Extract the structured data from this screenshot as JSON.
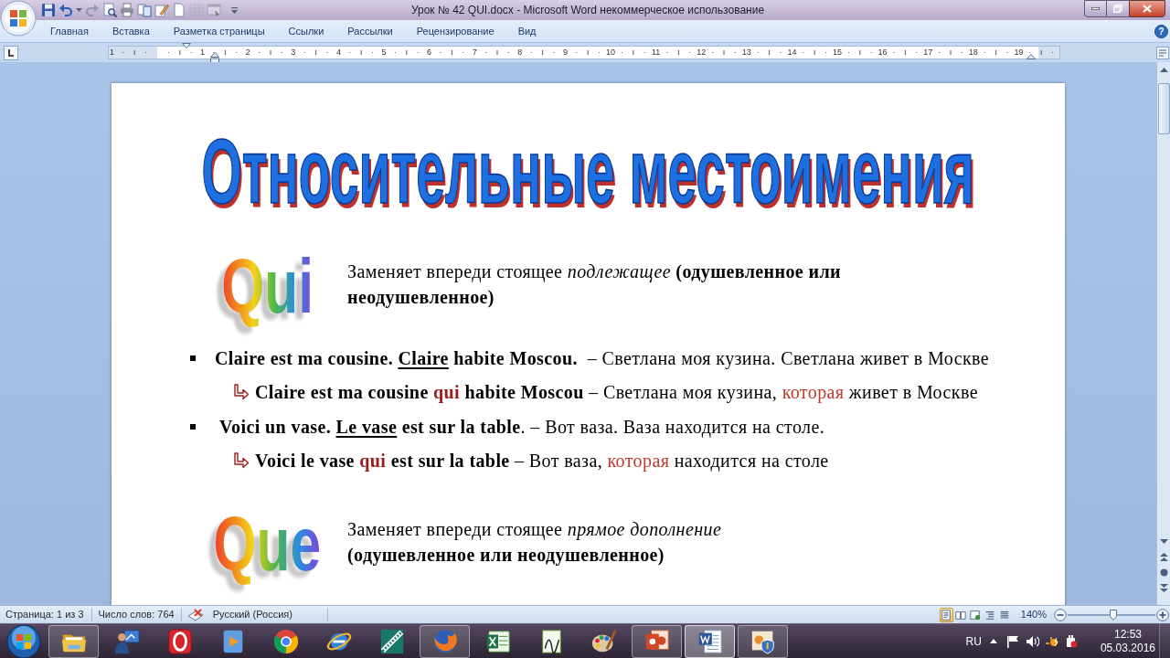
{
  "window": {
    "title": "Урок № 42 QUI.docx - Microsoft Word некоммерческое использование"
  },
  "quick_access": [
    {
      "kind": "save",
      "disabled": false
    },
    {
      "kind": "undo",
      "disabled": false
    },
    {
      "kind": "caret",
      "disabled": false
    },
    {
      "kind": "redo",
      "disabled": true
    },
    {
      "kind": "preview",
      "disabled": false
    },
    {
      "kind": "print",
      "disabled": false
    },
    {
      "kind": "pages",
      "disabled": false
    },
    {
      "kind": "draw",
      "disabled": false
    },
    {
      "kind": "page",
      "disabled": false
    },
    {
      "kind": "table",
      "disabled": true
    },
    {
      "kind": "screen",
      "disabled": true
    },
    {
      "kind": "customize",
      "disabled": false
    }
  ],
  "ribbon": {
    "tabs": [
      {
        "label": "Главная",
        "selected": false
      },
      {
        "label": "Вставка",
        "selected": false
      },
      {
        "label": "Разметка страницы",
        "selected": false
      },
      {
        "label": "Ссылки",
        "selected": false
      },
      {
        "label": "Рассылки",
        "selected": false
      },
      {
        "label": "Рецензирование",
        "selected": false
      },
      {
        "label": "Вид",
        "selected": false
      }
    ],
    "help": "?"
  },
  "ruler": {
    "labels": [
      "1",
      "1",
      "2",
      "3",
      "4",
      "5",
      "6",
      "7",
      "8",
      "9",
      "10",
      "11",
      "12",
      "13",
      "14",
      "15",
      "16",
      "17",
      "18",
      "19"
    ]
  },
  "document": {
    "title": "Относительные местоимения",
    "sections": [
      {
        "pronoun": "Qui",
        "description": "Заменяет впереди стоящее *подлежащее* **(одушевленное или неодушевленное)**",
        "examples": [
          {
            "segments": [
              {
                "kind": "bold",
                "text": "Claire est ma cousine. "
              },
              {
                "kind": "bold-underline",
                "text": "Claire"
              },
              {
                "kind": "bold",
                "text": " habite Moscou."
              },
              {
                "kind": "plain",
                "text": "  – Светлана моя кузина. Светлана живет в Москве"
              }
            ],
            "children": [
              {
                "segments": [
                  {
                    "kind": "bold",
                    "text": "Claire est ma cousine "
                  },
                  {
                    "kind": "bold-accent",
                    "text": "qui"
                  },
                  {
                    "kind": "bold",
                    "text": " habite Moscou"
                  },
                  {
                    "kind": "plain",
                    "text": " – Светлана моя кузина, "
                  },
                  {
                    "kind": "accent",
                    "text": "которая"
                  },
                  {
                    "kind": "plain",
                    "text": " живет в Москве"
                  }
                ]
              }
            ]
          },
          {
            "segments": [
              {
                "kind": "bold",
                "text": " Voici un vase. "
              },
              {
                "kind": "bold-underline",
                "text": "Le vase"
              },
              {
                "kind": "bold",
                "text": " est sur la table"
              },
              {
                "kind": "plain",
                "text": ". – Вот ваза. Ваза находится на столе."
              }
            ],
            "children": [
              {
                "segments": [
                  {
                    "kind": "bold",
                    "text": "Voici le vase "
                  },
                  {
                    "kind": "bold-accent",
                    "text": "qui"
                  },
                  {
                    "kind": "bold",
                    "text": " est sur la table"
                  },
                  {
                    "kind": "plain",
                    "text": " – Вот ваза, "
                  },
                  {
                    "kind": "accent",
                    "text": "которая"
                  },
                  {
                    "kind": "plain",
                    "text": " находится на столе"
                  }
                ]
              }
            ]
          }
        ]
      },
      {
        "pronoun": "Que",
        "description": "Заменяет впереди стоящее *прямое дополнение*\n**(одушевленное или неодушевленное)**"
      }
    ]
  },
  "status_bar": {
    "page": "Страница: 1 из 3",
    "words": "Число слов: 764",
    "language": "Русский (Россия)",
    "views": [
      {
        "kind": "print-layout",
        "selected": true
      },
      {
        "kind": "reading",
        "selected": false
      },
      {
        "kind": "web",
        "selected": false
      },
      {
        "kind": "outline",
        "selected": false
      },
      {
        "kind": "draft",
        "selected": false
      }
    ],
    "zoom": {
      "reading": "140%",
      "level": 0.52
    }
  },
  "taskbar": {
    "apps": [
      {
        "kind": "folder",
        "open": true,
        "selected": false
      },
      {
        "kind": "presenter",
        "open": false,
        "selected": false
      },
      {
        "kind": "ring",
        "open": false,
        "selected": false
      },
      {
        "kind": "player",
        "open": false,
        "selected": false
      },
      {
        "kind": "wheel",
        "open": false,
        "selected": false
      },
      {
        "kind": "orbit",
        "open": false,
        "selected": false
      },
      {
        "kind": "film",
        "open": false,
        "selected": false
      },
      {
        "kind": "globe",
        "open": true,
        "selected": false
      },
      {
        "kind": "spreadsheet",
        "open": false,
        "selected": false
      },
      {
        "kind": "chart",
        "open": false,
        "selected": false
      },
      {
        "kind": "palette",
        "open": false,
        "selected": false
      },
      {
        "kind": "slides",
        "open": true,
        "selected": false
      },
      {
        "kind": "document",
        "open": true,
        "selected": true
      },
      {
        "kind": "shield",
        "open": true,
        "selected": false
      }
    ],
    "language": "RU",
    "time": "12:53",
    "date": "05.03.2016"
  }
}
